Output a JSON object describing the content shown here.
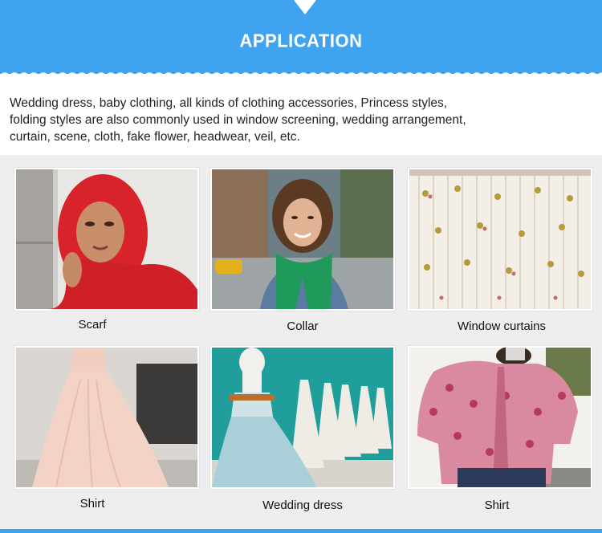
{
  "header": {
    "title": "APPLICATION",
    "accent_color": "#3fa3f0"
  },
  "intro": {
    "lines": [
      "Wedding dress, baby clothing, all kinds of clothing accessories, Princess styles,",
      "folding styles are also commonly used in window screening, wedding arrangement,",
      "curtain, scene, cloth, fake flower, headwear, veil, etc."
    ]
  },
  "gallery": [
    {
      "caption": "Scarf",
      "photo": "woman-red-headscarf"
    },
    {
      "caption": "Collar",
      "photo": "woman-green-scarf-denim"
    },
    {
      "caption": "Window curtains",
      "photo": "floral-sheer-curtains"
    },
    {
      "caption": "Shirt",
      "photo": "pink-tulle-skirt"
    },
    {
      "caption": "Wedding dress",
      "photo": "blue-tulle-wedding-gown"
    },
    {
      "caption": "Shirt",
      "photo": "floral-tie-neck-blouse"
    }
  ]
}
